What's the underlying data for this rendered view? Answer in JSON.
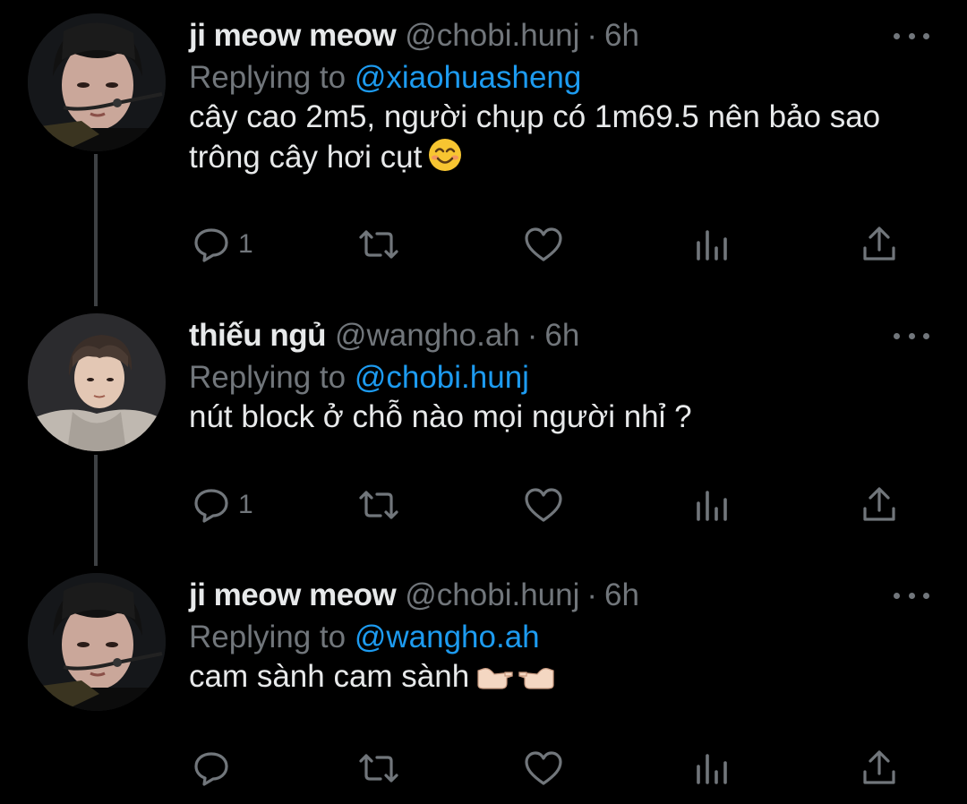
{
  "colors": {
    "background": "#000000",
    "text_primary": "#e7e9ea",
    "text_secondary": "#71767b",
    "mention": "#1d9bf0",
    "thread_line": "#3e4144"
  },
  "tweets": [
    {
      "name": "ji meow meow",
      "handle": "@chobi.hunj",
      "separator": "·",
      "time": "6h",
      "replying_prefix": "Replying to",
      "replying_to": "@xiaohuasheng",
      "text": "cây cao 2m5, người chụp có 1m69.5 nên bảo sao trông cây hơi cụt",
      "emoji": "smiling-face-emoji",
      "reply_count": "1",
      "icons": [
        "reply-icon",
        "retweet-icon",
        "like-icon",
        "views-icon",
        "share-icon"
      ]
    },
    {
      "name": "thiếu ngủ",
      "handle": "@wangho.ah",
      "separator": "·",
      "time": "6h",
      "replying_prefix": "Replying to",
      "replying_to": "@chobi.hunj",
      "text": "nút block ở chỗ nào mọi người nhỉ ?",
      "reply_count": "1",
      "icons": [
        "reply-icon",
        "retweet-icon",
        "like-icon",
        "views-icon",
        "share-icon"
      ]
    },
    {
      "name": "ji meow meow",
      "handle": "@chobi.hunj",
      "separator": "·",
      "time": "6h",
      "replying_prefix": "Replying to",
      "replying_to": "@wangho.ah",
      "text": "cam sành cam sành",
      "emoji": "pointing-hands-emoji",
      "reply_count": "",
      "icons": [
        "reply-icon",
        "retweet-icon",
        "like-icon",
        "views-icon",
        "share-icon"
      ]
    }
  ]
}
